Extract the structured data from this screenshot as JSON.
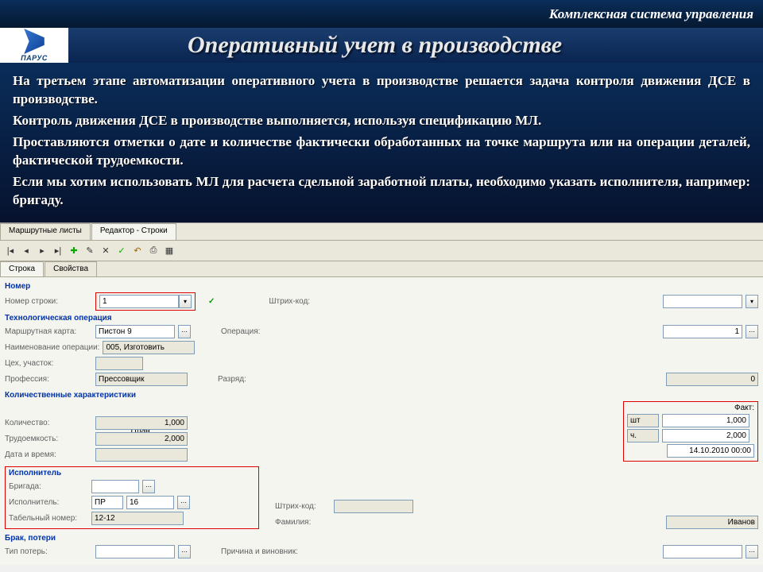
{
  "header": {
    "suite": "Комплексная система управления",
    "title": "Оперативный учет в производстве",
    "brand": "ПАРУС"
  },
  "paragraphs": [
    "На третьем этапе автоматизации оперативного учета в производстве решается задача контроля движения ДСЕ в производстве.",
    "Контроль движения ДСЕ в производстве выполняется, используя спецификацию МЛ.",
    "Проставляются отметки о дате и количестве фактически обработанных на точке маршрута или на операции деталей, фактической трудоемкости.",
    "Если мы хотим использовать МЛ для расчета сдельной заработной платы, необходимо указать исполнителя, например: бригаду."
  ],
  "tabs": {
    "t1": "Маршрутные листы",
    "t2": "Редактор - Строки"
  },
  "innerTabs": {
    "t1": "Строка",
    "t2": "Свойства"
  },
  "sections": {
    "number": "Номер",
    "techop": "Технологическая операция",
    "qty": "Количественные характеристики",
    "performer": "Исполнитель",
    "defect": "Брак, потери"
  },
  "labels": {
    "lineNo": "Номер строки:",
    "barcode": "Штрих-код:",
    "routeCard": "Маршрутная карта:",
    "operation": "Операция:",
    "opName": "Наименование операции:",
    "shop": "Цех, участок:",
    "profession": "Профессия:",
    "rank": "Разряд:",
    "plan": "План:",
    "fact": "Факт:",
    "quantity": "Количество:",
    "labor": "Трудоемкость:",
    "datetime": "Дата и время:",
    "brigade": "Бригада:",
    "performer": "Исполнитель:",
    "tabno": "Табельный номер:",
    "surname": "Фамилия:",
    "lossType": "Тип потерь:",
    "cause": "Причина и виновник:"
  },
  "values": {
    "lineNo": "1",
    "routeCard": "Пистон 9",
    "operation": "1",
    "opName": "005, Изготовить",
    "profession": "Прессовщик",
    "rank": "0",
    "qtyPlan": "1,000",
    "laborPlan": "2,000",
    "qtyFact": "1,000",
    "laborFact": "2,000",
    "unitQty": "шт",
    "unitLabor": "ч.",
    "datetime": "14.10.2010 00:00",
    "perfCode": "ПР",
    "perfNum": "16",
    "tabno": "12-12",
    "surname": "Иванов"
  }
}
